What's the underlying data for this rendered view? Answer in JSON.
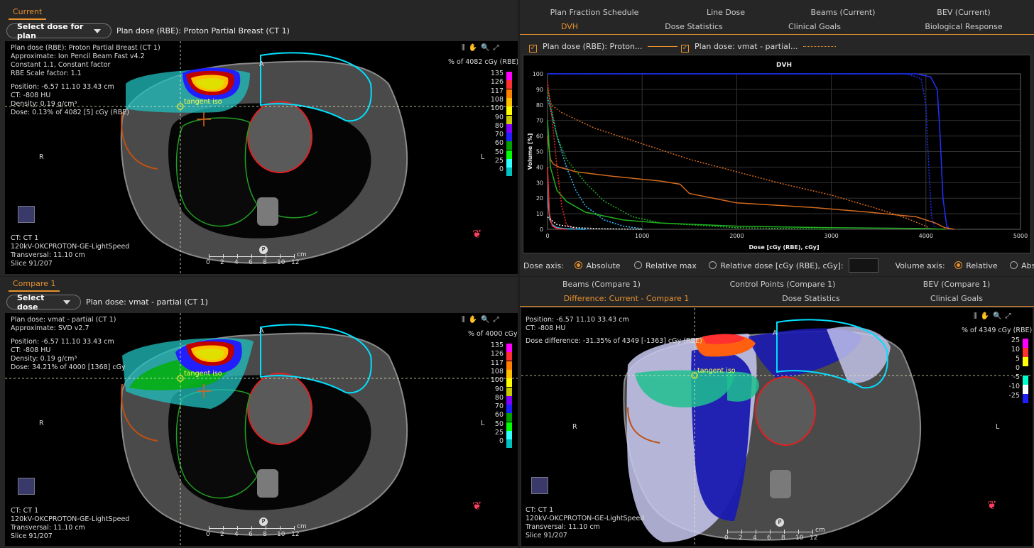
{
  "current": {
    "tab": "Current",
    "select_btn": "Select dose for plan",
    "plan_label": "Plan dose (RBE): Proton Partial Breast (CT 1)",
    "info_lines": [
      "Plan dose (RBE): Proton Partial Breast (CT 1)",
      "Approximate: Ion Pencil Beam Fast v4.2",
      "Constant 1.1, Constant factor",
      "RBE Scale factor: 1.1",
      "Position: -6.57 11.10 33.43 cm",
      "CT: -808 HU",
      "Density: 0.19 g/cm³",
      "Dose: 0.13% of 4082 [5] cGy (RBE)"
    ],
    "scale_title": "% of 4082 cGy (RBE)",
    "ct_lines": [
      "CT: CT 1",
      "120kV-OKCPROTON-GE-LightSpeed",
      "Transversal: 11.10 cm",
      "Slice 91/207"
    ],
    "tangent": "tangent iso"
  },
  "compare": {
    "tab": "Compare 1",
    "select_btn": "Select dose",
    "plan_label": "Plan dose: vmat - partial (CT 1)",
    "info_lines": [
      "Plan dose: vmat - partial (CT 1)",
      "Approximate: SVD v2.7",
      "",
      "Position: -6.57 11.10 33.43 cm",
      "CT: -808 HU",
      "Density: 0.19 g/cm³",
      "Dose: 34.21% of 4000 [1368] cGy"
    ],
    "scale_title": "% of 4000 cGy",
    "ct_lines": [
      "CT: CT 1",
      "120kV-OKCPROTON-GE-LightSpeed",
      "Transversal: 11.10 cm",
      "Slice 91/207"
    ],
    "tangent": "tangent iso"
  },
  "diff": {
    "info_lines": [
      "Position: -6.57 11.10 33.43 cm",
      "CT: -808 HU",
      "Dose difference: -31.35% of 4349 [-1363] cGy (RBE)"
    ],
    "scale_title": "% of 4349 cGy (RBE)",
    "legend": [
      "25",
      "10",
      "5",
      "0",
      "-5",
      "-10",
      "-25"
    ],
    "ct_lines": [
      "CT: CT 1",
      "120kV-OKCPROTON-GE-LightSpeed",
      "Transversal: 11.10 cm",
      "Slice 91/207"
    ],
    "tangent": "tangent iso"
  },
  "dose_legend": [
    "135",
    "126",
    "117",
    "108",
    "100",
    "90",
    "80",
    "70",
    "60",
    "50",
    "25",
    "0"
  ],
  "dose_colors": [
    "#ff00ff",
    "#ff3030",
    "#ff8000",
    "#ffbf00",
    "#ffff00",
    "#c8c800",
    "#8000ff",
    "#2020ff",
    "#00a000",
    "#00ff00",
    "#30ffff",
    "#00c0c0"
  ],
  "diff_colors": [
    "#ff00ff",
    "#ff3030",
    "#ffff00",
    "#000000",
    "#00ffcc",
    "#ffffff",
    "#2020ff"
  ],
  "orient": {
    "R": "R",
    "L": "L",
    "A": "A",
    "P": "P"
  },
  "ruler": {
    "ticks": [
      "0",
      "2",
      "4",
      "6",
      "8",
      "10",
      "12"
    ],
    "unit": "cm"
  },
  "top_tabs_row1": [
    "Plan Fraction Schedule",
    "Line Dose",
    "Beams (Current)",
    "BEV (Current)"
  ],
  "top_tabs_row2": [
    "DVH",
    "Dose Statistics",
    "Clinical Goals",
    "Biological Response"
  ],
  "dvh_legend": [
    "Plan dose (RBE): Proton...",
    "Plan dose: vmat - partial..."
  ],
  "bottom_tabs_row1": [
    "Beams (Compare 1)",
    "Control Points (Compare 1)",
    "BEV (Compare 1)"
  ],
  "bottom_tabs_row2": [
    "Difference: Current - Compare 1",
    "Dose Statistics",
    "Clinical Goals"
  ],
  "axis_controls": {
    "dose_axis": "Dose axis:",
    "absolute": "Absolute",
    "relative_max": "Relative max",
    "relative_dose": "Relative dose [cGy (RBE), cGy]:",
    "volume_axis": "Volume axis:",
    "relative": "Relative",
    "absolute2": "Absolute"
  },
  "chart_data": {
    "type": "line",
    "title": "DVH",
    "xlabel": "Dose [cGy (RBE), cGy]",
    "ylabel": "Volume [%]",
    "xlim": [
      0,
      5000
    ],
    "ylim": [
      0,
      100
    ],
    "xticks": [
      0,
      1000,
      2000,
      3000,
      4000,
      5000
    ],
    "yticks": [
      0,
      10,
      20,
      30,
      40,
      50,
      60,
      70,
      80,
      90,
      100
    ],
    "series": [
      {
        "color": "#2030ff",
        "dash": false,
        "x": [
          0,
          3900,
          4050,
          4120,
          4150,
          4180,
          4220,
          4260
        ],
        "y": [
          100,
          100,
          98,
          90,
          60,
          20,
          2,
          0
        ]
      },
      {
        "color": "#2030ff",
        "dash": true,
        "x": [
          0,
          3800,
          3950,
          4000,
          4030,
          4060,
          4100
        ],
        "y": [
          100,
          100,
          97,
          80,
          40,
          8,
          0
        ]
      },
      {
        "color": "#d2691e",
        "dash": false,
        "x": [
          0,
          30,
          60,
          120,
          300,
          700,
          1200,
          1400,
          1500,
          2000,
          2800,
          3400,
          3900,
          4100,
          4200,
          4300
        ],
        "y": [
          60,
          45,
          42,
          40,
          37,
          34,
          31,
          29,
          23,
          17,
          14,
          11,
          8,
          4,
          1,
          0
        ]
      },
      {
        "color": "#d2691e",
        "dash": true,
        "x": [
          0,
          40,
          150,
          500,
          1000,
          1500,
          2000,
          2500,
          3000,
          3500,
          3800,
          4000,
          4050
        ],
        "y": [
          90,
          80,
          75,
          65,
          55,
          45,
          37,
          29,
          22,
          13,
          7,
          2,
          0
        ]
      },
      {
        "color": "#30c0ff",
        "dash": false,
        "x": [
          0,
          10,
          25,
          50,
          100,
          200,
          400
        ],
        "y": [
          40,
          15,
          6,
          3,
          1,
          0.3,
          0
        ]
      },
      {
        "color": "#30c0ff",
        "dash": true,
        "x": [
          0,
          100,
          200,
          300,
          400,
          600,
          800,
          1000
        ],
        "y": [
          85,
          60,
          40,
          25,
          15,
          6,
          2,
          0.3
        ]
      },
      {
        "color": "#20b020",
        "dash": false,
        "x": [
          0,
          30,
          100,
          200,
          400,
          800,
          1200,
          2000,
          2500,
          3000,
          4000,
          4200
        ],
        "y": [
          70,
          40,
          25,
          18,
          11,
          6,
          4,
          2,
          1.5,
          1,
          0.5,
          0
        ]
      },
      {
        "color": "#20b020",
        "dash": true,
        "x": [
          0,
          100,
          200,
          400,
          600,
          900,
          1200,
          2000,
          3000
        ],
        "y": [
          90,
          60,
          45,
          30,
          18,
          8,
          4,
          1,
          0
        ]
      },
      {
        "color": "#ff2020",
        "dash": false,
        "x": [
          0,
          20,
          50,
          100,
          200
        ],
        "y": [
          40,
          10,
          2,
          0.5,
          0
        ]
      },
      {
        "color": "#ff2020",
        "dash": true,
        "x": [
          0,
          50,
          100,
          150,
          200,
          300
        ],
        "y": [
          95,
          70,
          40,
          15,
          3,
          0
        ]
      },
      {
        "color": "#f0f0f0",
        "dash": true,
        "x": [
          0,
          100,
          300,
          600,
          1000
        ],
        "y": [
          8,
          3,
          1,
          0.3,
          0
        ]
      }
    ]
  }
}
